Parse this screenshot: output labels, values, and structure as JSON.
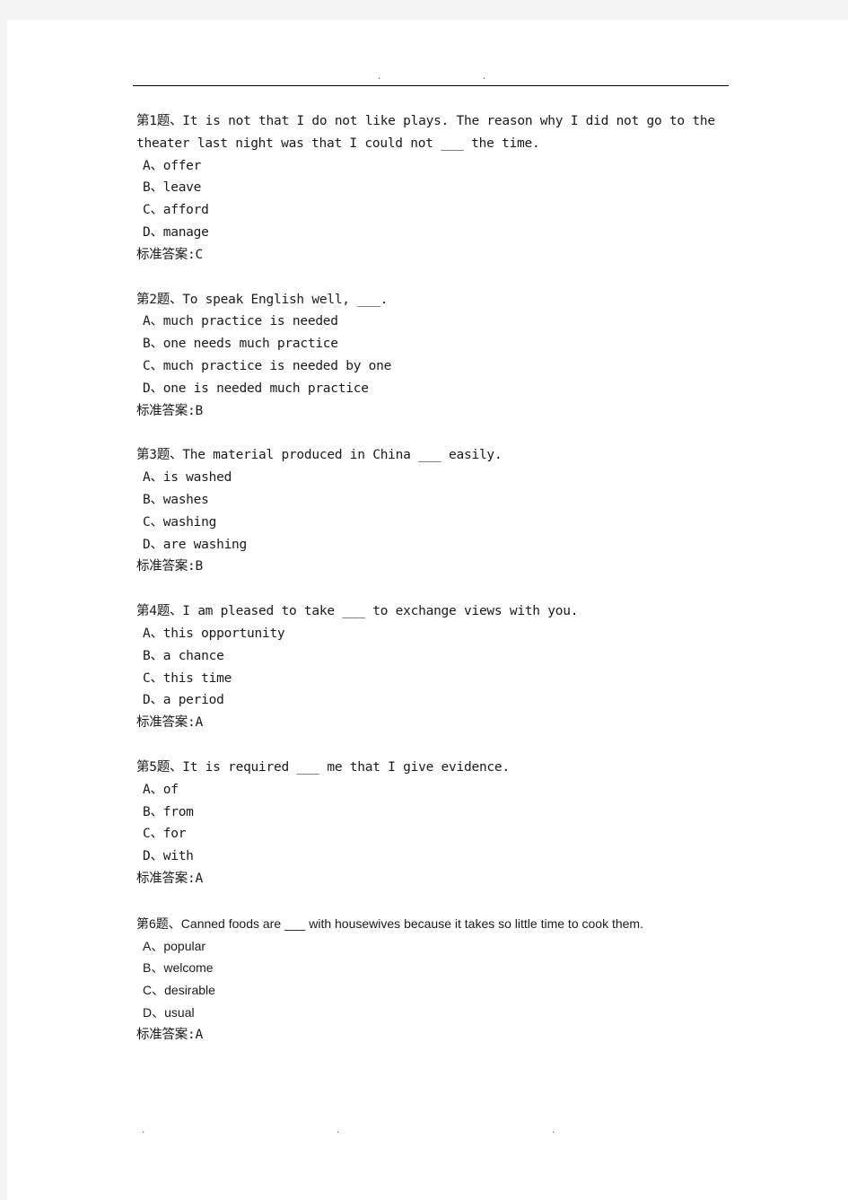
{
  "document": {
    "header_marks": [
      ".",
      "."
    ],
    "footer_marks": [
      ".",
      ".",
      "."
    ],
    "answer_label": "标准答案:",
    "questions": [
      {
        "prefix": "第1题、",
        "stem": "It is not that I do not like plays. The reason why I did not go to the theater last night was that I could not ___ the time.",
        "options": [
          {
            "letter": "A、",
            "text": "offer"
          },
          {
            "letter": "B、",
            "text": "leave"
          },
          {
            "letter": "C、",
            "text": "afford"
          },
          {
            "letter": "D、",
            "text": "manage"
          }
        ],
        "answer": "标准答案:C"
      },
      {
        "prefix": "第2题、",
        "stem": "To speak English well, ___.",
        "options": [
          {
            "letter": "A、",
            "text": "much practice is needed"
          },
          {
            "letter": "B、",
            "text": "one needs much practice"
          },
          {
            "letter": "C、",
            "text": "much practice is needed by one"
          },
          {
            "letter": "D、",
            "text": "one is needed much practice"
          }
        ],
        "answer": "标准答案:B"
      },
      {
        "prefix": "第3题、",
        "stem": "The material produced in China ___ easily.",
        "options": [
          {
            "letter": "A、",
            "text": "is washed"
          },
          {
            "letter": "B、",
            "text": "washes"
          },
          {
            "letter": "C、",
            "text": "washing"
          },
          {
            "letter": "D、",
            "text": "are washing"
          }
        ],
        "answer": "标准答案:B"
      },
      {
        "prefix": "第4题、",
        "stem": "I am pleased to take ___ to exchange views with you.",
        "options": [
          {
            "letter": "A、",
            "text": "this opportunity"
          },
          {
            "letter": "B、",
            "text": "a chance"
          },
          {
            "letter": "C、",
            "text": "this time"
          },
          {
            "letter": "D、",
            "text": "a period"
          }
        ],
        "answer": "标准答案:A"
      },
      {
        "prefix": "第5题、",
        "stem": "It is required ___ me that I give evidence.",
        "options": [
          {
            "letter": "A、",
            "text": "of"
          },
          {
            "letter": "B、",
            "text": "from"
          },
          {
            "letter": "C、",
            "text": "for"
          },
          {
            "letter": "D、",
            "text": "with"
          }
        ],
        "answer": "标准答案:A"
      },
      {
        "prefix": "第6题、",
        "stem": "Canned foods are ___ with housewives because it takes so little time to cook them.",
        "options": [
          {
            "letter": "A、",
            "text": "popular"
          },
          {
            "letter": "B、",
            "text": "welcome"
          },
          {
            "letter": "C、",
            "text": "desirable"
          },
          {
            "letter": "D、",
            "text": "usual"
          }
        ],
        "answer": "标准答案:A"
      }
    ]
  }
}
